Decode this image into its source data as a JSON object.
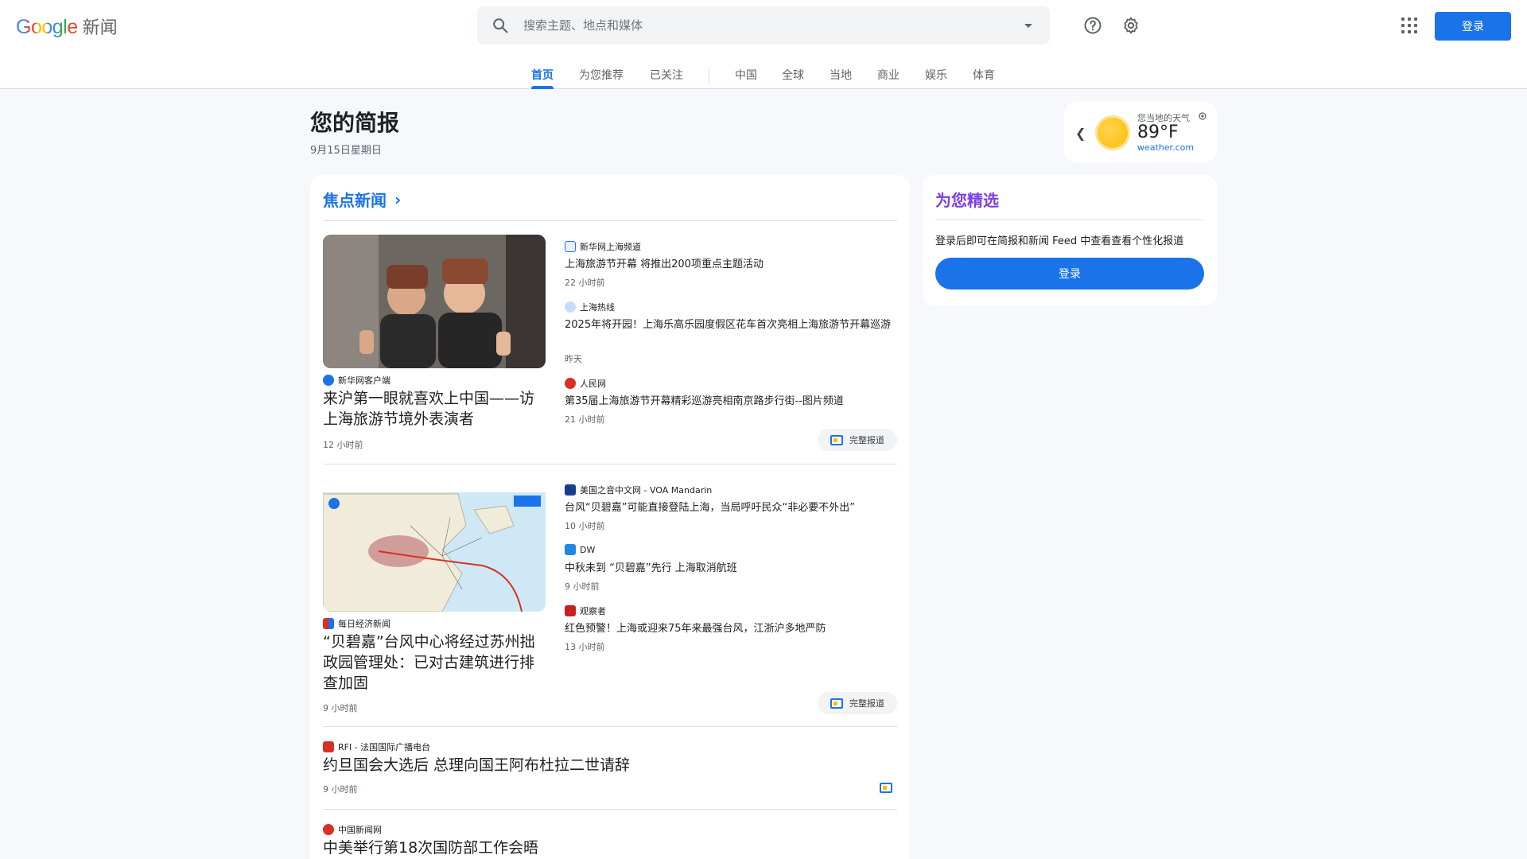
{
  "header": {
    "logo_google": "Google",
    "logo_product": "新闻",
    "search_placeholder": "搜索主题、地点和媒体",
    "signin_label": "登录"
  },
  "tabs": [
    {
      "label": "首页",
      "active": true
    },
    {
      "label": "为您推荐"
    },
    {
      "label": "已关注"
    },
    {
      "label": "中国"
    },
    {
      "label": "全球"
    },
    {
      "label": "当地"
    },
    {
      "label": "商业"
    },
    {
      "label": "娱乐"
    },
    {
      "label": "体育"
    }
  ],
  "briefing": {
    "title": "您的简报",
    "date": "9月15日星期日"
  },
  "weather": {
    "label": "您当地的天气",
    "temperature": "89°F",
    "source": "weather.com"
  },
  "top_stories": {
    "title": "焦点新闻",
    "clusters": [
      {
        "main": {
          "source": "新华网客户端",
          "headline": "来沪第一眼就喜欢上中国——访上海旅游节境外表演者",
          "time": "12 小时前"
        },
        "related": [
          {
            "source": "新华网上海频道",
            "headline": "上海旅游节开幕 将推出200项重点主题活动",
            "time": "22 小时前"
          },
          {
            "source": "上海热线",
            "headline": "2025年将开园！上海乐高乐园度假区花车首次亮相上海旅游节开幕巡游",
            "time": "昨天"
          },
          {
            "source": "人民网",
            "headline": "第35届上海旅游节开幕精彩巡游亮相南京路步行街--图片频道",
            "time": "21 小时前"
          }
        ],
        "full_coverage": "完整报道"
      },
      {
        "main": {
          "source": "每日经济新闻",
          "headline": "“贝碧嘉”台风中心将经过苏州拙政园管理处：已对古建筑进行排查加固",
          "time": "9 小时前"
        },
        "related": [
          {
            "source": "美国之音中文网 - VOA Mandarin",
            "headline": "台风“贝碧嘉”可能直接登陆上海，当局呼吁民众“非必要不外出”",
            "time": "10 小时前"
          },
          {
            "source": "DW",
            "headline": "中秋未到 “贝碧嘉”先行 上海取消航班",
            "time": "9 小时前"
          },
          {
            "source": "观察者",
            "headline": "红色预警！上海或迎来75年来最强台风，江浙沪多地严防",
            "time": "13 小时前"
          }
        ],
        "full_coverage": "完整报道"
      },
      {
        "main": {
          "source": "RFI - 法国国际广播电台",
          "headline": "约旦国会大选后 总理向国王阿布杜拉二世请辞",
          "time": "9 小时前"
        }
      },
      {
        "main": {
          "source": "中国新闻网",
          "headline": "中美举行第18次国防部工作会晤"
        }
      }
    ]
  },
  "for_you": {
    "title": "为您精选",
    "text": "登录后即可在简报和新闻 Feed 中查看查看个性化报道",
    "button": "登录"
  },
  "colors": {
    "accent": "#1a73e8",
    "for_you_title": "#7b3fe4",
    "background": "#f6f8fc"
  }
}
